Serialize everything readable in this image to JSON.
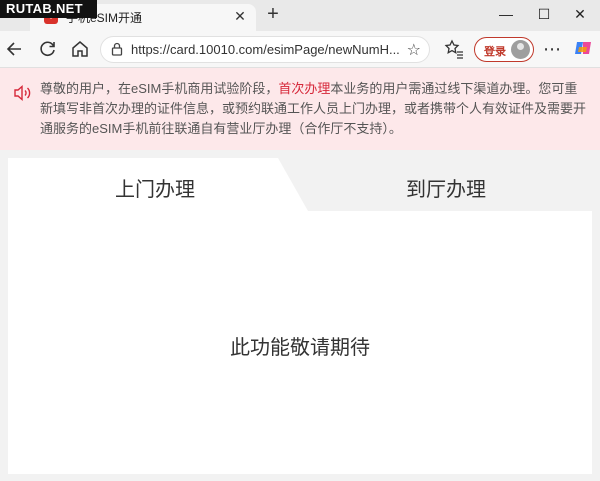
{
  "watermark": "RUTAB.NET",
  "browser": {
    "tab_title": "手机eSIM开通",
    "new_tab_symbol": "+",
    "close_symbol": "✕",
    "url": "https://card.10010.com/esimPage/newNumH...",
    "login_label": "登录"
  },
  "notice": {
    "prefix": "尊敬的用户，在eSIM手机商用试验阶段，",
    "highlight": "首次办理",
    "suffix": "本业务的用户需通过线下渠道办理。您可重新填写非首次办理的证件信息，或预约联通工作人员上门办理，或者携带个人有效证件及需要开通服务的eSIM手机前往联通自有营业厅办理（合作厅不支持）。",
    "highlight_color": "#d6283a"
  },
  "service_tabs": [
    {
      "label": "上门办理",
      "active": true
    },
    {
      "label": "到厅办理",
      "active": false
    }
  ],
  "content": {
    "placeholder": "此功能敬请期待"
  },
  "icons": {
    "back": "back-arrow-icon",
    "refresh": "refresh-icon",
    "home": "home-icon",
    "lock": "lock-icon",
    "favorite": "star-icon",
    "favorites_list": "favorites-icon",
    "more": "more-icon",
    "copilot": "copilot-icon",
    "speaker": "speaker-icon"
  }
}
